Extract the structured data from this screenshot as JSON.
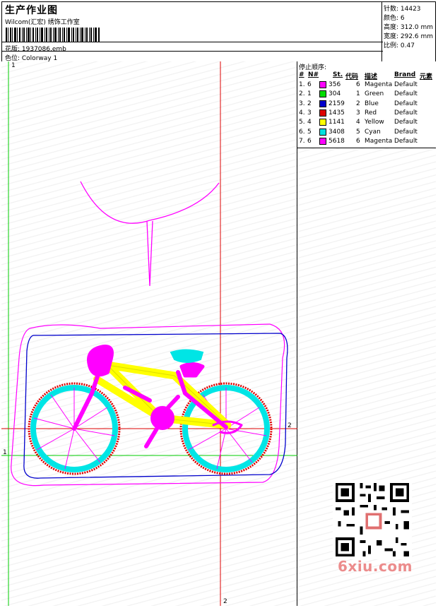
{
  "header": {
    "title": "生产作业图",
    "company": "Wilcom(汇宏) 绣饰工作室",
    "file_label": "花版: 1937086.emb",
    "colorway_label": "色位:  Colorway 1"
  },
  "stats": {
    "stitches": "针数:  14423",
    "colors": "颜色:  6",
    "height": "高度:  312.0 mm",
    "width": "宽度:  292.6 mm",
    "scale": "比例:  0.47"
  },
  "stop_sequence": {
    "caption": "停止顺序:",
    "headers": [
      "#",
      "N#",
      "St.",
      "代码",
      "描述",
      "Brand",
      "元素"
    ],
    "rows": [
      {
        "idx": "1.",
        "n": "6",
        "color": "#ff00ff",
        "st": "356",
        "code": "6",
        "desc": "Magenta",
        "brand": "Default"
      },
      {
        "idx": "2.",
        "n": "1",
        "color": "#00dd00",
        "st": "304",
        "code": "1",
        "desc": "Green",
        "brand": "Default"
      },
      {
        "idx": "3.",
        "n": "2",
        "color": "#0000cc",
        "st": "2159",
        "code": "2",
        "desc": "Blue",
        "brand": "Default"
      },
      {
        "idx": "4.",
        "n": "3",
        "color": "#dd0000",
        "st": "1435",
        "code": "3",
        "desc": "Red",
        "brand": "Default"
      },
      {
        "idx": "5.",
        "n": "4",
        "color": "#ffff00",
        "st": "1141",
        "code": "4",
        "desc": "Yellow",
        "brand": "Default"
      },
      {
        "idx": "6.",
        "n": "5",
        "color": "#00e0e0",
        "st": "3408",
        "code": "5",
        "desc": "Cyan",
        "brand": "Default"
      },
      {
        "idx": "7.",
        "n": "6",
        "color": "#ff00ff",
        "st": "5618",
        "code": "6",
        "desc": "Magenta",
        "brand": "Default"
      }
    ]
  },
  "axes": {
    "top_marker": "1",
    "right_marker": "2",
    "bottom_marker": "2",
    "left_marker": "1"
  },
  "watermark": "6xiu.com",
  "colors": {
    "magenta": "#ff00ff",
    "cyan": "#00e5e5",
    "yellow": "#ffff00",
    "blue": "#0000cc",
    "red": "#dd0000",
    "green": "#00cc00"
  }
}
